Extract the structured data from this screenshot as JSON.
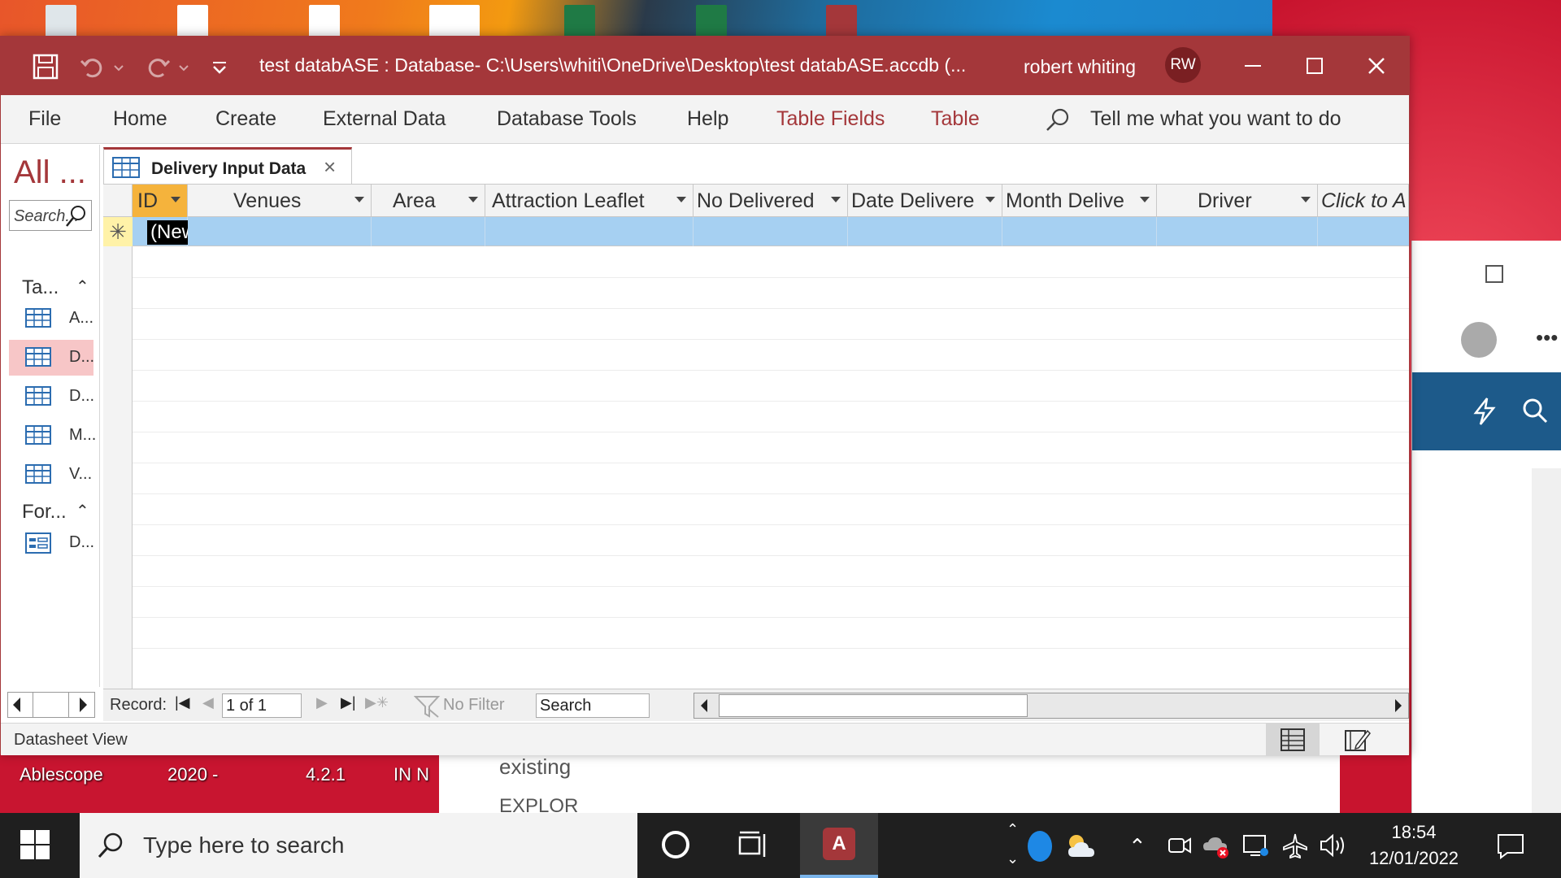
{
  "desktop": {
    "labels": [
      "Ablescope",
      "2020 -",
      "4.2.1",
      "IN N",
      "existing",
      "EXPLOR"
    ]
  },
  "window": {
    "title": "test databASE : Database- C:\\Users\\whiti\\OneDrive\\Desktop\\test databASE.accdb (...",
    "user_name": "robert whiting",
    "user_initials": "RW",
    "accent": "#a4373a"
  },
  "ribbon": {
    "tabs": [
      "File",
      "Home",
      "Create",
      "External Data",
      "Database Tools",
      "Help"
    ],
    "context_tabs": [
      "Table Fields",
      "Table"
    ],
    "tell_me": "Tell me what you want to do"
  },
  "nav": {
    "header": "All ...",
    "search_placeholder": "Search...",
    "groups": [
      {
        "label": "Ta...",
        "items": [
          "A...",
          "D...",
          "D...",
          "M...",
          "V..."
        ]
      },
      {
        "label": "For...",
        "items": [
          "D..."
        ]
      }
    ]
  },
  "document": {
    "tab_label": "Delivery Input Data",
    "columns": [
      "ID",
      "Venues",
      "Area",
      "Attraction Leaflet",
      "No Delivered",
      "Date Delivere",
      "Month Delive",
      "Driver",
      "Click to A"
    ],
    "new_record_text": "(New)",
    "new_row_marker": "✳"
  },
  "record_nav": {
    "label": "Record:",
    "position": "1 of 1",
    "filter": "No Filter",
    "search": "Search"
  },
  "status": {
    "text": "Datasheet View"
  },
  "taskbar": {
    "search_placeholder": "Type here to search",
    "time": "18:54",
    "date": "12/01/2022"
  }
}
